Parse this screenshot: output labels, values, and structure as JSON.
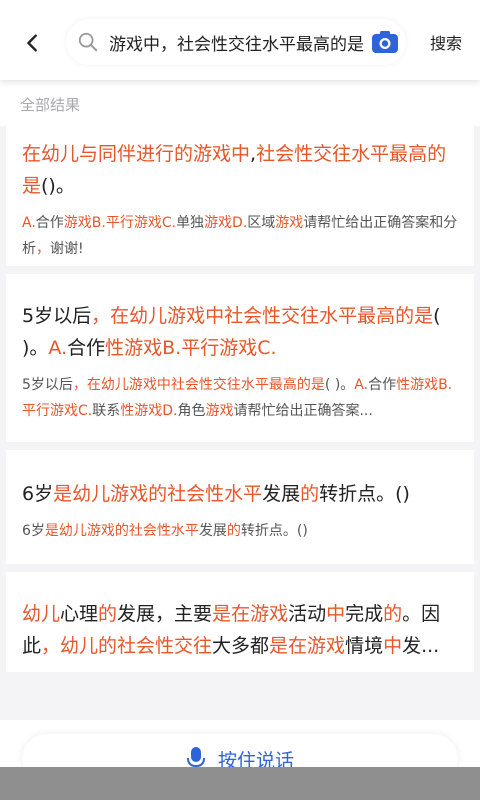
{
  "header": {
    "search_query": "在幼儿与同伴进行的游戏中，社会性交往水平最高的是",
    "search_button": "搜索"
  },
  "results": {
    "section_label": "全部结果",
    "items": [
      {
        "title": [
          {
            "t": "在幼儿与同伴进行的游戏中",
            "h": true
          },
          {
            "t": ",",
            "h": false
          },
          {
            "t": "社会性交往水平最高的是",
            "h": true
          },
          {
            "t": "()。",
            "h": false
          }
        ],
        "desc": [
          {
            "t": "A.",
            "h": true
          },
          {
            "t": "合作",
            "h": false
          },
          {
            "t": "游戏B.平行游戏C.",
            "h": true
          },
          {
            "t": "单独",
            "h": false
          },
          {
            "t": "游戏D.",
            "h": true
          },
          {
            "t": "区域",
            "h": false
          },
          {
            "t": "游戏",
            "h": true
          },
          {
            "t": "请帮忙给出正确答案和分析",
            "h": false
          },
          {
            "t": "，",
            "h": true
          },
          {
            "t": "谢谢!",
            "h": false
          }
        ]
      },
      {
        "title": [
          {
            "t": "5岁以后",
            "h": false
          },
          {
            "t": "，在幼儿游戏中社会性交往水平最高的是",
            "h": true
          },
          {
            "t": "( )。",
            "h": false
          },
          {
            "t": "A.",
            "h": true
          },
          {
            "t": "合作",
            "h": false
          },
          {
            "t": "性游戏B.平行游戏C.",
            "h": true
          }
        ],
        "desc": [
          {
            "t": "5岁以后",
            "h": false
          },
          {
            "t": "，在幼儿游戏中社会性交往水平最高的是",
            "h": true
          },
          {
            "t": "( )。",
            "h": false
          },
          {
            "t": "A.",
            "h": true
          },
          {
            "t": "合作",
            "h": false
          },
          {
            "t": "性游戏B.平行游戏C.",
            "h": true
          },
          {
            "t": "联系",
            "h": false
          },
          {
            "t": "性游戏D.",
            "h": true
          },
          {
            "t": "角色",
            "h": false
          },
          {
            "t": "游戏",
            "h": true
          },
          {
            "t": "请帮忙给出正确答案...",
            "h": false
          }
        ]
      },
      {
        "title": [
          {
            "t": "6岁",
            "h": false
          },
          {
            "t": "是幼儿游戏的社会性水平",
            "h": true
          },
          {
            "t": "发展",
            "h": false
          },
          {
            "t": "的",
            "h": true
          },
          {
            "t": "转折点。()",
            "h": false
          }
        ],
        "desc": [
          {
            "t": "6岁",
            "h": false
          },
          {
            "t": "是幼儿游戏的社会性水平",
            "h": true
          },
          {
            "t": "发展",
            "h": false
          },
          {
            "t": "的",
            "h": true
          },
          {
            "t": "转折点。()",
            "h": false
          }
        ]
      },
      {
        "title": [
          {
            "t": "幼儿",
            "h": true
          },
          {
            "t": "心理",
            "h": false
          },
          {
            "t": "的",
            "h": true
          },
          {
            "t": "发展，主要",
            "h": false
          },
          {
            "t": "是在游戏",
            "h": true
          },
          {
            "t": "活动",
            "h": false
          },
          {
            "t": "中",
            "h": true
          },
          {
            "t": "完成",
            "h": false
          },
          {
            "t": "的",
            "h": true
          },
          {
            "t": "。因此",
            "h": false
          },
          {
            "t": "，幼儿的社会性交往",
            "h": true
          },
          {
            "t": "大多都",
            "h": false
          },
          {
            "t": "是在游戏",
            "h": true
          },
          {
            "t": "情境",
            "h": false
          },
          {
            "t": "中",
            "h": true
          },
          {
            "t": "发...",
            "h": false
          }
        ],
        "desc": []
      }
    ]
  },
  "footer": {
    "voice_label": "按住说话"
  },
  "colors": {
    "highlight": "#e8562a",
    "accent_blue": "#2f63d8"
  },
  "icons": [
    "back-arrow-icon",
    "search-icon",
    "camera-icon",
    "microphone-icon"
  ]
}
